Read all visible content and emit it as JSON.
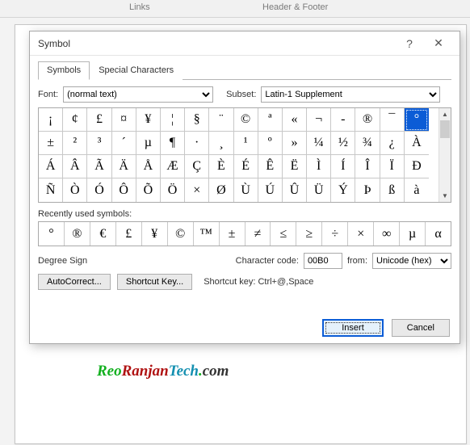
{
  "ribbon": {
    "links": "Links",
    "header_footer": "Header & Footer"
  },
  "dialog": {
    "title": "Symbol",
    "help": "?",
    "close": "✕",
    "tabs": {
      "symbols": "Symbols",
      "special": "Special Characters"
    },
    "font_label": "Font:",
    "font_value": "(normal text)",
    "subset_label": "Subset:",
    "subset_value": "Latin-1 Supplement",
    "grid": [
      [
        "¡",
        "¢",
        "£",
        "¤",
        "¥",
        "¦",
        "§",
        "¨",
        "©",
        "ª",
        "«",
        "¬",
        "-",
        "®",
        "¯",
        "°"
      ],
      [
        "±",
        "²",
        "³",
        "´",
        "µ",
        "¶",
        "·",
        "¸",
        "¹",
        "º",
        "»",
        "¼",
        "½",
        "¾",
        "¿",
        "À"
      ],
      [
        "Á",
        "Â",
        "Ã",
        "Ä",
        "Å",
        "Æ",
        "Ç",
        "È",
        "É",
        "Ê",
        "Ë",
        "Ì",
        "Í",
        "Î",
        "Ï",
        "Ð"
      ],
      [
        "Ñ",
        "Ò",
        "Ó",
        "Ô",
        "Õ",
        "Ö",
        "×",
        "Ø",
        "Ù",
        "Ú",
        "Û",
        "Ü",
        "Ý",
        "Þ",
        "ß",
        "à"
      ]
    ],
    "selected_rc": "0,15",
    "recent_label": "Recently used symbols:",
    "recent": [
      "°",
      "®",
      "€",
      "£",
      "¥",
      "©",
      "™",
      "±",
      "≠",
      "≤",
      "≥",
      "÷",
      "×",
      "∞",
      "µ",
      "α"
    ],
    "symbol_name": "Degree Sign",
    "code_label": "Character code:",
    "code_value": "00B0",
    "from_label": "from:",
    "from_value": "Unicode (hex)",
    "autocorrect": "AutoCorrect...",
    "shortcutkey": "Shortcut Key...",
    "shortcut_text": "Shortcut key: Ctrl+@,Space",
    "insert": "Insert",
    "cancel": "Cancel"
  },
  "watermark": {
    "p1": "Reo",
    "p2": "Ranjan",
    "p3": "Tech",
    "p4": ".",
    "p5": "com"
  }
}
